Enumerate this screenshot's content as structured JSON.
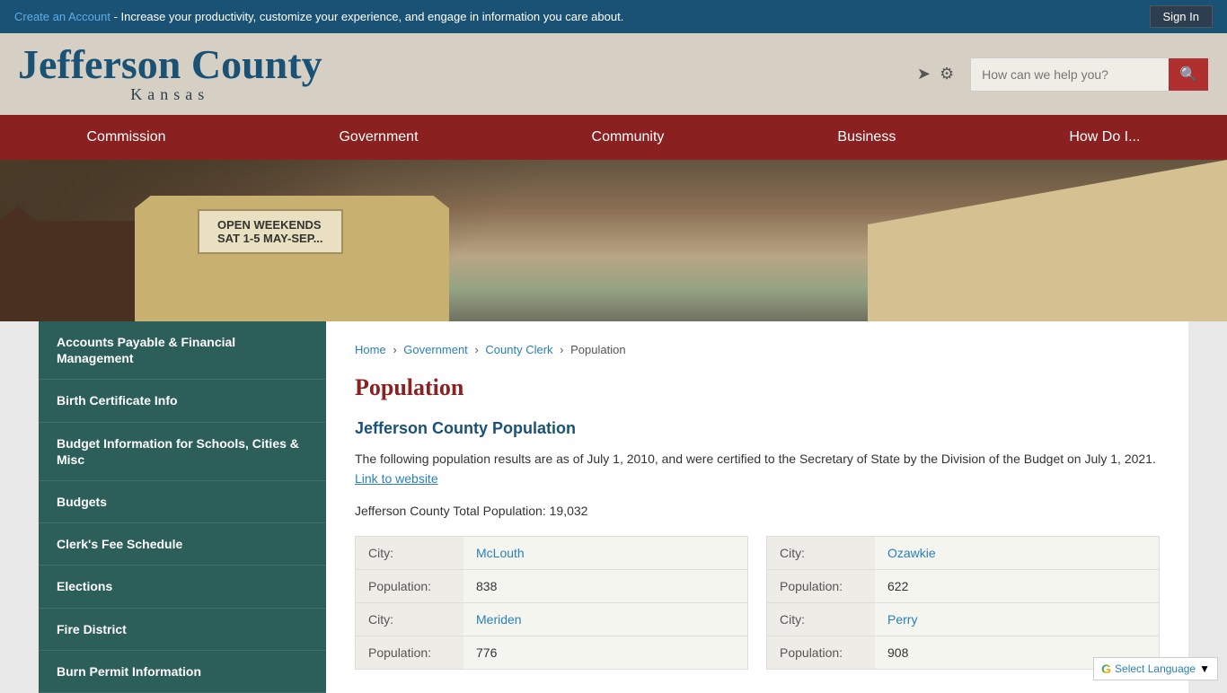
{
  "topbar": {
    "cta_link": "Create an Account",
    "cta_text": " - Increase your productivity, customize your experience, and engage in information you care about.",
    "signin_label": "Sign In"
  },
  "header": {
    "logo_title": "Jefferson County",
    "logo_subtitle": "Kansas",
    "search_placeholder": "How can we help you?"
  },
  "nav": {
    "items": [
      {
        "label": "Commission"
      },
      {
        "label": "Government"
      },
      {
        "label": "Community"
      },
      {
        "label": "Business"
      },
      {
        "label": "How Do I..."
      }
    ]
  },
  "hero": {
    "sign_line1": "OPEN WEEKENDS",
    "sign_line2": "SAT 1-5   MAY-SEP..."
  },
  "sidebar": {
    "items": [
      {
        "label": "Accounts Payable & Financial Management"
      },
      {
        "label": "Birth Certificate Info"
      },
      {
        "label": "Budget Information for Schools, Cities & Misc"
      },
      {
        "label": "Budgets"
      },
      {
        "label": "Clerk's Fee Schedule"
      },
      {
        "label": "Elections"
      },
      {
        "label": "Fire District"
      },
      {
        "label": "Burn Permit Information"
      }
    ]
  },
  "breadcrumb": {
    "home": "Home",
    "government": "Government",
    "county_clerk": "County Clerk",
    "current": "Population"
  },
  "main": {
    "page_title": "Population",
    "section_title": "Jefferson County Population",
    "description": "The following population results are as of July 1, 2010, and were certified to the Secretary of State by the Division of the Budget on July 1, 2021.",
    "link_text": "Link to website",
    "total_population": "Jefferson County Total Population: 19,032",
    "cities_left": [
      {
        "city_label": "City:",
        "city_value": "McLouth",
        "pop_label": "Population:",
        "pop_value": "838"
      },
      {
        "city_label": "City:",
        "city_value": "Meriden",
        "pop_label": "Population:",
        "pop_value": "776"
      }
    ],
    "cities_right": [
      {
        "city_label": "City:",
        "city_value": "Ozawkie",
        "pop_label": "Population:",
        "pop_value": "622"
      },
      {
        "city_label": "City:",
        "city_value": "Perry",
        "pop_label": "Population:",
        "pop_value": "908"
      }
    ]
  },
  "footer": {
    "select_language": "Select Language"
  }
}
